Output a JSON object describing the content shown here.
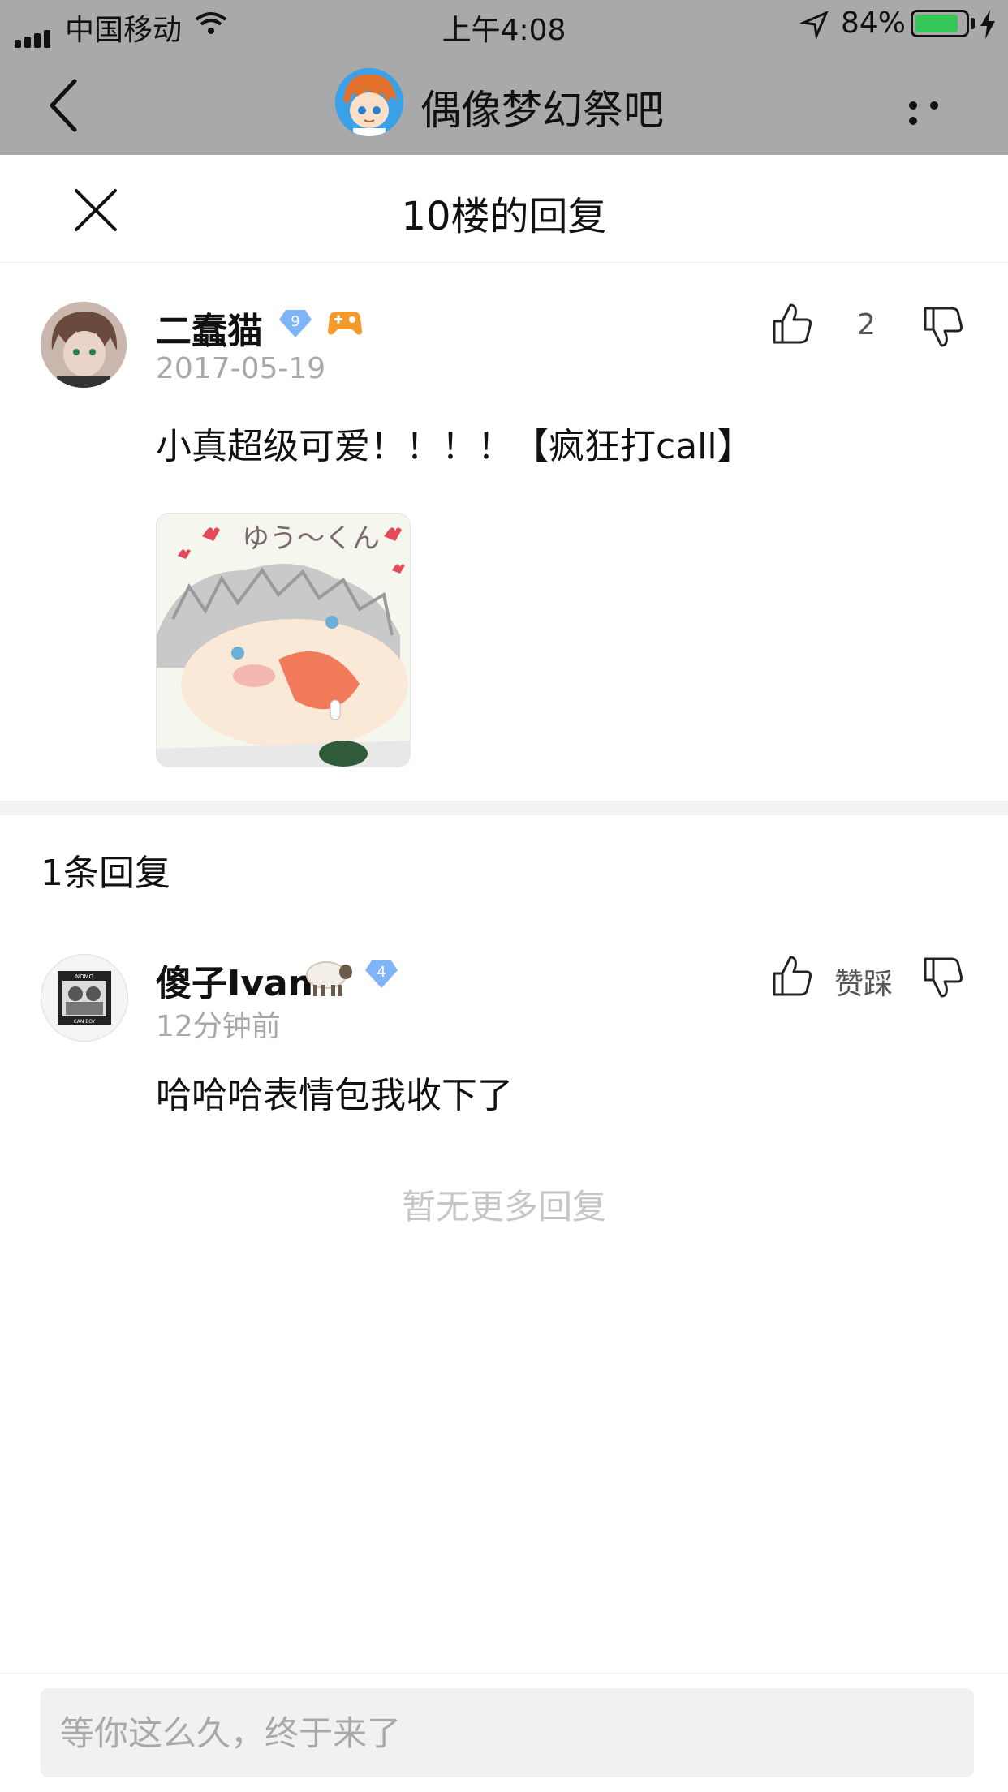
{
  "status_bar": {
    "carrier": "中国移动",
    "time": "上午4:08",
    "battery_percent": "84%",
    "battery_level": 0.84,
    "icons": [
      "signal-icon",
      "wifi-icon",
      "location-arrow-icon",
      "battery-icon",
      "charging-bolt-icon"
    ]
  },
  "header": {
    "title": "偶像梦幻祭吧",
    "back_icon": "chevron-left-icon",
    "more_icon": "more-dots-icon",
    "background": "#a9a9a9"
  },
  "sheet": {
    "title": "10楼的回复",
    "close_icon": "close-icon"
  },
  "main_post": {
    "author": "二蠢猫",
    "level_badge": "9",
    "date": "2017-05-19",
    "like_count": "2",
    "content": "小真超级可爱！！！！【疯狂打call】",
    "sticker_text": "ゆう～くん"
  },
  "replies": {
    "count_label": "1条回复",
    "items": [
      {
        "author": "傻子Ivan",
        "level_badge": "4",
        "time": "12分钟前",
        "like_label": "赞踩",
        "content": "哈哈哈表情包我收下了",
        "avatar_text_top": "NOMO",
        "avatar_text_bottom": "CAN BOY"
      }
    ],
    "no_more": "暂无更多回复"
  },
  "input": {
    "placeholder": "等你这么久，终于来了"
  },
  "colors": {
    "accent_badge": "#7fb4f8",
    "battery_green": "#35c759",
    "muted_text": "#a8a8a8"
  }
}
